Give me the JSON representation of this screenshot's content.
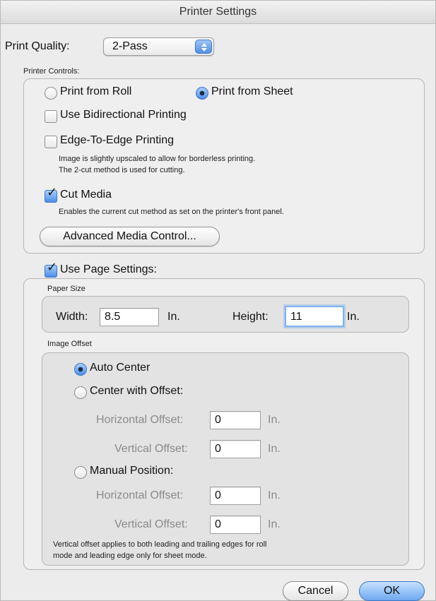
{
  "window": {
    "title": "Printer Settings"
  },
  "print_quality": {
    "label": "Print Quality:",
    "value": "2-Pass"
  },
  "printer_controls": {
    "title": "Printer Controls:",
    "print_from_roll": "Print from Roll",
    "print_from_sheet": "Print from Sheet",
    "use_bidirectional": "Use Bidirectional Printing",
    "edge_to_edge": "Edge-To-Edge Printing",
    "edge_desc_1": "Image is slightly upscaled to allow for borderless printing.",
    "edge_desc_2": "The 2-cut method is used for cutting.",
    "cut_media": "Cut Media",
    "cut_media_desc": "Enables the current cut method as set on the printer's front panel.",
    "advanced_button": "Advanced Media Control..."
  },
  "page_settings": {
    "use_page_settings": "Use Page Settings:",
    "paper_size": {
      "title": "Paper Size",
      "width_label": "Width:",
      "width_value": "8.5",
      "width_unit": "In.",
      "height_label": "Height:",
      "height_value": "11",
      "height_unit": "In."
    },
    "image_offset": {
      "title": "Image Offset",
      "auto_center": "Auto Center",
      "center_with_offset": "Center with Offset:",
      "horizontal_offset_label": "Horizontal Offset:",
      "vertical_offset_label": "Vertical Offset:",
      "manual_position": "Manual Position:",
      "offset_unit": "In.",
      "center_h_value": "0",
      "center_v_value": "0",
      "manual_h_value": "0",
      "manual_v_value": "0",
      "note_1": "Vertical offset applies to both leading and trailing edges for roll",
      "note_2": "mode and leading edge only for sheet mode."
    }
  },
  "buttons": {
    "cancel": "Cancel",
    "ok": "OK"
  }
}
